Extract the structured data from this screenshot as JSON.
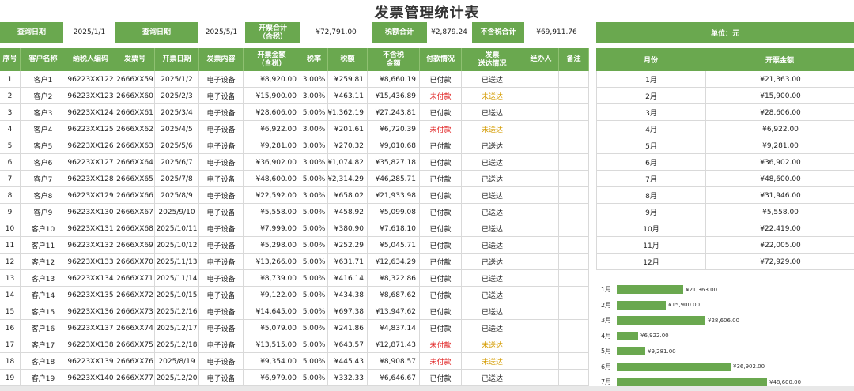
{
  "title": "发票管理统计表",
  "topbar": {
    "query_date_label_1": "查询日期",
    "query_date_value_1": "2025/1/1",
    "query_date_label_2": "查询日期",
    "query_date_value_2": "2025/5/1",
    "invoice_total_label": "开票合计\n（含税）",
    "invoice_total_value": "¥72,791.00",
    "tax_total_label": "税额合计",
    "tax_total_value": "¥2,879.24",
    "untaxed_total_label": "不含税合计",
    "untaxed_total_value": "¥69,911.76"
  },
  "side_unit": "单位：元",
  "main_headers": [
    "序号",
    "客户名称",
    "纳税人编码",
    "发票号",
    "开票日期",
    "发票内容",
    "开票金额\n（含税）",
    "税率",
    "税额",
    "不含税\n金额",
    "付款情况",
    "发票\n送达情况",
    "经办人",
    "备注"
  ],
  "rows": [
    [
      "1",
      "客户1",
      "96223XX122",
      "2666XX59",
      "2025/1/2",
      "电子设备",
      "¥8,920.00",
      "3.00%",
      "¥259.81",
      "¥8,660.19",
      "已付款",
      "已送达",
      "",
      ""
    ],
    [
      "2",
      "客户2",
      "96223XX123",
      "2666XX60",
      "2025/2/3",
      "电子设备",
      "¥15,900.00",
      "3.00%",
      "¥463.11",
      "¥15,436.89",
      "未付款",
      "未送达",
      "",
      ""
    ],
    [
      "3",
      "客户3",
      "96223XX124",
      "2666XX61",
      "2025/3/4",
      "电子设备",
      "¥28,606.00",
      "5.00%",
      "¥1,362.19",
      "¥27,243.81",
      "已付款",
      "已送达",
      "",
      ""
    ],
    [
      "4",
      "客户4",
      "96223XX125",
      "2666XX62",
      "2025/4/5",
      "电子设备",
      "¥6,922.00",
      "3.00%",
      "¥201.61",
      "¥6,720.39",
      "未付款",
      "未送达",
      "",
      ""
    ],
    [
      "5",
      "客户5",
      "96223XX126",
      "2666XX63",
      "2025/5/6",
      "电子设备",
      "¥9,281.00",
      "3.00%",
      "¥270.32",
      "¥9,010.68",
      "已付款",
      "已送达",
      "",
      ""
    ],
    [
      "6",
      "客户6",
      "96223XX127",
      "2666XX64",
      "2025/6/7",
      "电子设备",
      "¥36,902.00",
      "3.00%",
      "¥1,074.82",
      "¥35,827.18",
      "已付款",
      "已送达",
      "",
      ""
    ],
    [
      "7",
      "客户7",
      "96223XX128",
      "2666XX65",
      "2025/7/8",
      "电子设备",
      "¥48,600.00",
      "5.00%",
      "¥2,314.29",
      "¥46,285.71",
      "已付款",
      "已送达",
      "",
      ""
    ],
    [
      "8",
      "客户8",
      "96223XX129",
      "2666XX66",
      "2025/8/9",
      "电子设备",
      "¥22,592.00",
      "3.00%",
      "¥658.02",
      "¥21,933.98",
      "已付款",
      "已送达",
      "",
      ""
    ],
    [
      "9",
      "客户9",
      "96223XX130",
      "2666XX67",
      "2025/9/10",
      "电子设备",
      "¥5,558.00",
      "5.00%",
      "¥458.92",
      "¥5,099.08",
      "已付款",
      "已送达",
      "",
      ""
    ],
    [
      "10",
      "客户10",
      "96223XX131",
      "2666XX68",
      "2025/10/11",
      "电子设备",
      "¥7,999.00",
      "5.00%",
      "¥380.90",
      "¥7,618.10",
      "已付款",
      "已送达",
      "",
      ""
    ],
    [
      "11",
      "客户11",
      "96223XX132",
      "2666XX69",
      "2025/10/12",
      "电子设备",
      "¥5,298.00",
      "5.00%",
      "¥252.29",
      "¥5,045.71",
      "已付款",
      "已送达",
      "",
      ""
    ],
    [
      "12",
      "客户12",
      "96223XX133",
      "2666XX70",
      "2025/11/13",
      "电子设备",
      "¥13,266.00",
      "5.00%",
      "¥631.71",
      "¥12,634.29",
      "已付款",
      "已送达",
      "",
      ""
    ],
    [
      "13",
      "客户13",
      "96223XX134",
      "2666XX71",
      "2025/11/14",
      "电子设备",
      "¥8,739.00",
      "5.00%",
      "¥416.14",
      "¥8,322.86",
      "已付款",
      "已送达",
      "",
      ""
    ],
    [
      "14",
      "客户14",
      "96223XX135",
      "2666XX72",
      "2025/10/15",
      "电子设备",
      "¥9,122.00",
      "5.00%",
      "¥434.38",
      "¥8,687.62",
      "已付款",
      "已送达",
      "",
      ""
    ],
    [
      "15",
      "客户15",
      "96223XX136",
      "2666XX73",
      "2025/12/16",
      "电子设备",
      "¥14,645.00",
      "5.00%",
      "¥697.38",
      "¥13,947.62",
      "已付款",
      "已送达",
      "",
      ""
    ],
    [
      "16",
      "客户16",
      "96223XX137",
      "2666XX74",
      "2025/12/17",
      "电子设备",
      "¥5,079.00",
      "5.00%",
      "¥241.86",
      "¥4,837.14",
      "已付款",
      "已送达",
      "",
      ""
    ],
    [
      "17",
      "客户17",
      "96223XX138",
      "2666XX75",
      "2025/12/18",
      "电子设备",
      "¥13,515.00",
      "5.00%",
      "¥643.57",
      "¥12,871.43",
      "未付款",
      "未送达",
      "",
      ""
    ],
    [
      "18",
      "客户18",
      "96223XX139",
      "2666XX76",
      "2025/8/19",
      "电子设备",
      "¥9,354.00",
      "5.00%",
      "¥445.43",
      "¥8,908.57",
      "未付款",
      "未送达",
      "",
      ""
    ],
    [
      "19",
      "客户19",
      "96223XX140",
      "2666XX77",
      "2025/12/20",
      "电子设备",
      "¥6,979.00",
      "5.00%",
      "¥332.33",
      "¥6,646.67",
      "已付款",
      "已送达",
      "",
      ""
    ]
  ],
  "side_headers": [
    "月份",
    "开票金额"
  ],
  "monthly": [
    [
      "1月",
      "¥21,363.00"
    ],
    [
      "2月",
      "¥15,900.00"
    ],
    [
      "3月",
      "¥28,606.00"
    ],
    [
      "4月",
      "¥6,922.00"
    ],
    [
      "5月",
      "¥9,281.00"
    ],
    [
      "6月",
      "¥36,902.00"
    ],
    [
      "7月",
      "¥48,600.00"
    ],
    [
      "8月",
      "¥31,946.00"
    ],
    [
      "9月",
      "¥5,558.00"
    ],
    [
      "10月",
      "¥22,419.00"
    ],
    [
      "11月",
      "¥22,005.00"
    ],
    [
      "12月",
      "¥72,929.00"
    ]
  ],
  "colors": {
    "accent": "#6aa84f",
    "unpaid": "#e02020",
    "undelivered": "#d49b00"
  },
  "chart_data": {
    "type": "bar",
    "orientation": "horizontal",
    "categories": [
      "1月",
      "2月",
      "3月",
      "4月",
      "5月",
      "6月",
      "7月"
    ],
    "values": [
      21363,
      15900,
      28606,
      6922,
      9281,
      36902,
      48600
    ],
    "value_labels": [
      "¥21,363.00",
      "¥15,900.00",
      "¥28,606.00",
      "¥6,922.00",
      "¥9,281.00",
      "¥36,902.00",
      "¥48,600.00"
    ],
    "title": "",
    "xlabel": "",
    "ylabel": "",
    "grid": false
  }
}
